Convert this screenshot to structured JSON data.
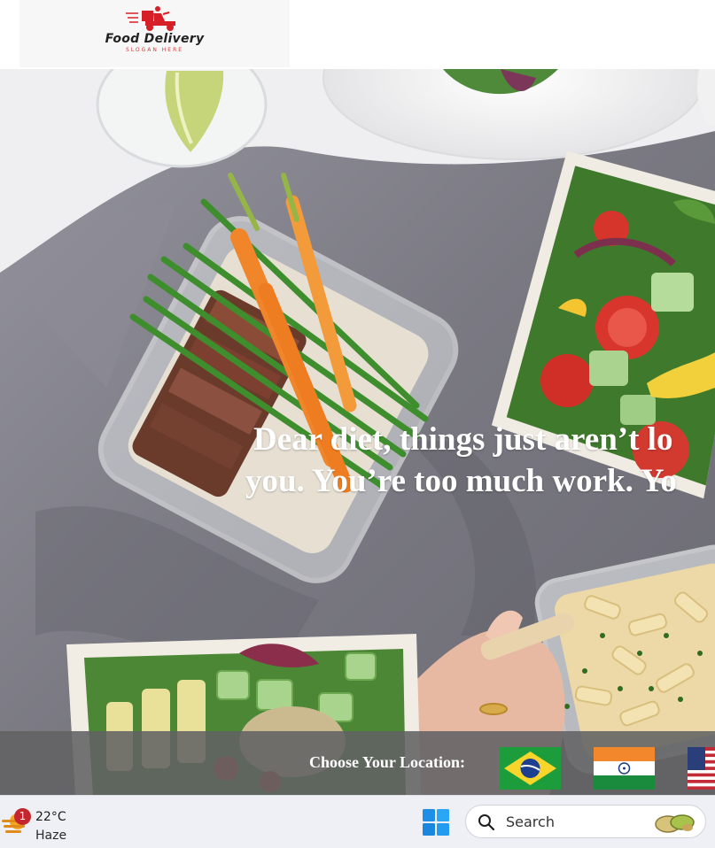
{
  "header": {
    "logo": {
      "name": "Food Delivery",
      "slogan": "SLOGAN HERE",
      "icon": "delivery-scooter-icon"
    }
  },
  "hero": {
    "headline_line1": "Dear diet, things just aren’t lo",
    "headline_line2": "you. You’re too much work. Yo",
    "background": "food-boxes-on-gray-tablecloth"
  },
  "location": {
    "label": "Choose Your Location:",
    "flags": [
      {
        "country": "Brazil",
        "icon": "brazil-flag-icon"
      },
      {
        "country": "India",
        "icon": "india-flag-icon"
      },
      {
        "country": "United States",
        "icon": "usa-flag-icon"
      }
    ]
  },
  "taskbar": {
    "weather": {
      "badge": "1",
      "temperature": "22°C",
      "condition": "Haze",
      "icon": "haze-weather-icon"
    },
    "start_icon": "windows-start-icon",
    "search": {
      "label": "Search",
      "icon": "search-icon"
    }
  },
  "colors": {
    "brand_red": "#d61f26",
    "overlay_gray": "#626264",
    "taskbar_bg": "#eef0f5",
    "windows_blue": "#1aa3f0"
  }
}
